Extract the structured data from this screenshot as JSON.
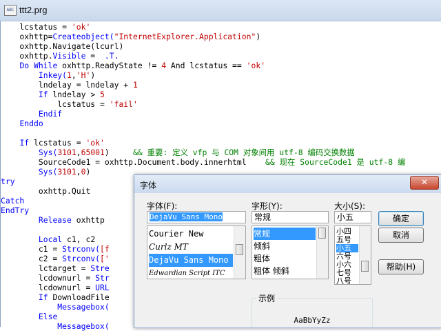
{
  "window": {
    "title": "ttt2.prg",
    "icon": "prg-file-icon"
  },
  "code_lines": [
    [
      [
        "    lcstatus = ",
        ""
      ],
      [
        "'ok'",
        "str"
      ]
    ],
    [
      [
        "    oxhttp=",
        ""
      ],
      [
        "Createobject(",
        "kw"
      ],
      [
        "\"InternetExplorer.Application\"",
        "str"
      ],
      [
        ")",
        ""
      ]
    ],
    [
      [
        "    oxhttp.Navigate(lcurl)",
        ""
      ]
    ],
    [
      [
        "    oxhttp.",
        ""
      ],
      [
        "Visible",
        "kw"
      ],
      [
        " =  ",
        ""
      ],
      [
        ".T.",
        "kw"
      ]
    ],
    [
      [
        "    ",
        ""
      ],
      [
        "Do While",
        "kw"
      ],
      [
        " oxhttp.ReadyState != ",
        ""
      ],
      [
        "4",
        "num"
      ],
      [
        " And lcstatus == ",
        ""
      ],
      [
        "'ok'",
        "str"
      ]
    ],
    [
      [
        "        ",
        ""
      ],
      [
        "Inkey(",
        "kw"
      ],
      [
        "1",
        "num"
      ],
      [
        ",",
        ""
      ],
      [
        "'H'",
        "str"
      ],
      [
        ")",
        ""
      ]
    ],
    [
      [
        "        lndelay = lndelay + ",
        ""
      ],
      [
        "1",
        "num"
      ]
    ],
    [
      [
        "        ",
        ""
      ],
      [
        "If",
        "kw"
      ],
      [
        " lndelay > ",
        ""
      ],
      [
        "5",
        "num"
      ]
    ],
    [
      [
        "            lcstatus = ",
        ""
      ],
      [
        "'fail'",
        "str"
      ]
    ],
    [
      [
        "        ",
        ""
      ],
      [
        "Endif",
        "kw"
      ]
    ],
    [
      [
        "    ",
        ""
      ],
      [
        "Enddo",
        "kw"
      ]
    ],
    [
      [
        "",
        ""
      ]
    ],
    [
      [
        "    ",
        ""
      ],
      [
        "If",
        "kw"
      ],
      [
        " lcstatus = ",
        ""
      ],
      [
        "'ok'",
        "str"
      ]
    ],
    [
      [
        "        ",
        ""
      ],
      [
        "Sys(",
        "kw"
      ],
      [
        "3101",
        "num"
      ],
      [
        ",",
        ""
      ],
      [
        "65001",
        "num"
      ],
      [
        ")     ",
        ""
      ],
      [
        "&& 重要: 定义 vfp 与 COM 对象间用 utf-8 编码交换数据",
        "cm"
      ]
    ],
    [
      [
        "        SourceCode1 = oxhttp.Document.body.innerhtml    ",
        ""
      ],
      [
        "&& 现在 SourceCode1 是 utf-8 编",
        "cm"
      ]
    ],
    [
      [
        "        ",
        ""
      ],
      [
        "Sys(",
        "kw"
      ],
      [
        "3101",
        "num"
      ],
      [
        ",",
        ""
      ],
      [
        "0",
        "num"
      ],
      [
        ")",
        ""
      ]
    ],
    [
      [
        "",
        ""
      ],
      [
        "try",
        "kw"
      ]
    ],
    [
      [
        "        oxhttp.Quit",
        ""
      ]
    ],
    [
      [
        "",
        ""
      ],
      [
        "Catch",
        "kw"
      ]
    ],
    [
      [
        "",
        ""
      ],
      [
        "EndTry",
        "kw"
      ]
    ],
    [
      [
        "        ",
        ""
      ],
      [
        "Release",
        "kw"
      ],
      [
        " oxhttp",
        ""
      ]
    ],
    [
      [
        "",
        ""
      ]
    ],
    [
      [
        "        ",
        ""
      ],
      [
        "Local",
        "kw"
      ],
      [
        " c1, c2",
        ""
      ]
    ],
    [
      [
        "        c1 = ",
        ""
      ],
      [
        "Strconv(",
        "kw"
      ],
      [
        "[f",
        "str"
      ]
    ],
    [
      [
        "        c2 = ",
        ""
      ],
      [
        "Strconv(",
        "kw"
      ],
      [
        "['",
        "str"
      ]
    ],
    [
      [
        "        lctarget = ",
        ""
      ],
      [
        "Stre",
        "kw"
      ]
    ],
    [
      [
        "        lcdownurl = ",
        ""
      ],
      [
        "Str",
        "kw"
      ]
    ],
    [
      [
        "        lcdownurl = ",
        ""
      ],
      [
        "URL",
        "kw"
      ]
    ],
    [
      [
        "        ",
        ""
      ],
      [
        "If",
        "kw"
      ],
      [
        " DownloadFile",
        ""
      ]
    ],
    [
      [
        "            ",
        ""
      ],
      [
        "Messagebox(",
        "kw"
      ]
    ],
    [
      [
        "        ",
        ""
      ],
      [
        "Else",
        "kw"
      ]
    ],
    [
      [
        "            ",
        ""
      ],
      [
        "Messagebox(",
        "kw"
      ]
    ]
  ],
  "font_dialog": {
    "title": "字体",
    "close_label": "✕",
    "font_label": "字体(F):",
    "font_value": "DejaVu Sans Mono",
    "font_list": [
      "Courier New",
      "Curlz MT",
      "DejaVu Sans Mono",
      "Edwardian Script ITC"
    ],
    "font_selected_index": 2,
    "style_label": "字形(Y):",
    "style_value": "常规",
    "style_list": [
      "常规",
      "倾斜",
      "粗体",
      "粗体 倾斜"
    ],
    "style_selected_index": 0,
    "size_label": "大小(S):",
    "size_value": "小五",
    "size_list": [
      "小四",
      "五号",
      "小五",
      "六号",
      "小六",
      "七号",
      "八号"
    ],
    "size_selected_index": 2,
    "ok_label": "确定",
    "cancel_label": "取消",
    "help_label": "帮助(H)",
    "sample_label": "示例",
    "sample_text": "AaBbYyZz"
  }
}
